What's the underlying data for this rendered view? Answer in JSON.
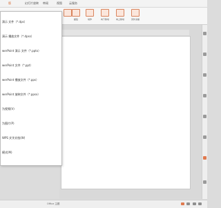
{
  "tabs": [
    "版",
    "幻灯片放映",
    "审阅",
    "视图",
    "云服务"
  ],
  "ribbon_tools": [
    {
      "label": "",
      "icon": "hyperlink-icon"
    },
    {
      "label": "超链",
      "icon": "hyperlink-icon"
    },
    {
      "label": "动作",
      "icon": "action-icon"
    },
    {
      "label": "向下移动",
      "icon": "move-down-icon"
    },
    {
      "label": "向上移动",
      "icon": "move-up-icon"
    },
    {
      "label": "另外演播",
      "icon": "play-icon"
    }
  ],
  "menu": {
    "items": [
      {
        "label": "演示 文件（*.dps）"
      },
      {
        "label": "演示 播放文件（*.dpss）"
      },
      {
        "label": "werPoint 演示 文件（*.pptx）"
      },
      {
        "label": "werPoint 文件（*.ppt）"
      },
      {
        "label": "werPoint 播放文件（*.pps）"
      },
      {
        "label": "werPoint 放映文件（*.ppsx）"
      },
      {
        "label": "为视频(V)"
      },
      {
        "label": "为图片(P)"
      },
      {
        "label": "WPS 文字文档(W)"
      },
      {
        "label": "模式(M)"
      }
    ]
  },
  "status": {
    "text": "Office 主题"
  },
  "colors": {
    "accent": "#e07a4f",
    "ribbon_icon": "#d9835c"
  }
}
